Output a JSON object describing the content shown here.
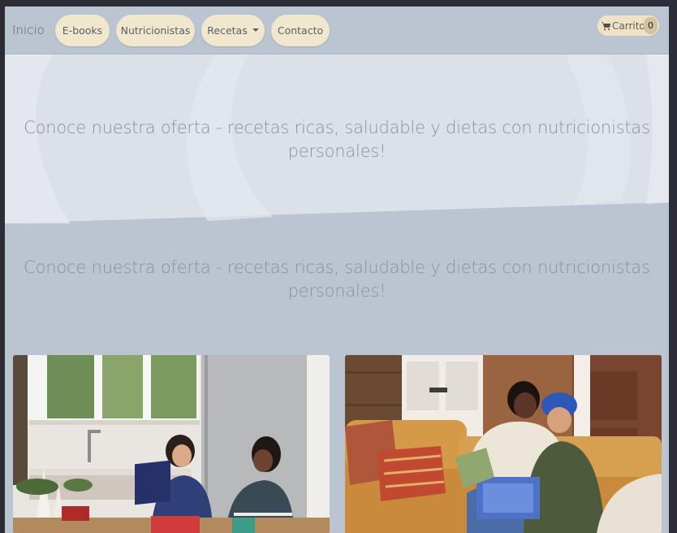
{
  "navbar": {
    "brand": "Inicio",
    "items": [
      {
        "label": "E-books"
      },
      {
        "label": "Nutricionistas"
      },
      {
        "label": "Recetas"
      },
      {
        "label": "Contacto"
      }
    ],
    "cart_label": "Carrito",
    "cart_count": "0"
  },
  "hero": {
    "headline": "Conoce nuestra oferta - recetas ricas, saludable y dietas con nutricionistas personales!"
  },
  "offers": {
    "title": "Conoce nuestra oferta - recetas ricas, saludable y dietas con nutricionistas personales!"
  },
  "colors": {
    "page_bg": "#bac5d1",
    "pill_bg": "#f1e7cf",
    "text": "#8a939c"
  }
}
